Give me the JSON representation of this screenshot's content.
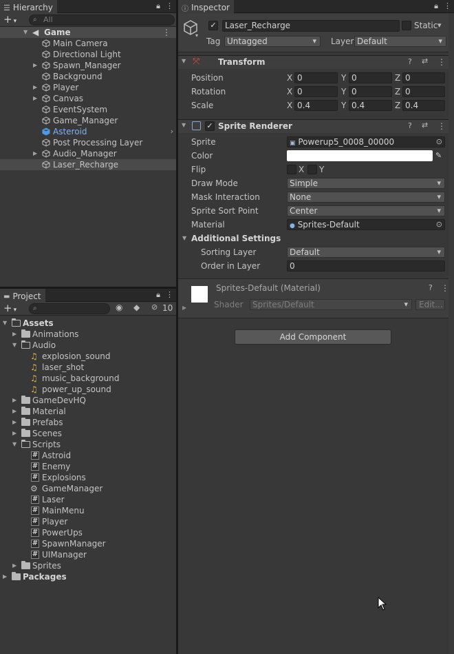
{
  "hierarchy": {
    "tab_label": "Hierarchy",
    "search_placeholder": "All",
    "add_label": "+",
    "scene_name": "Game",
    "items": [
      {
        "label": "Main Camera"
      },
      {
        "label": "Directional Light"
      },
      {
        "label": "Spawn_Manager"
      },
      {
        "label": "Background"
      },
      {
        "label": "Player"
      },
      {
        "label": "Canvas"
      },
      {
        "label": "EventSystem"
      },
      {
        "label": "Game_Manager"
      },
      {
        "label": "Asteroid"
      },
      {
        "label": "Post Processing Layer"
      },
      {
        "label": "Audio_Manager"
      },
      {
        "label": "Laser_Recharge"
      }
    ]
  },
  "project": {
    "tab_label": "Project",
    "add_label": "+",
    "hidden_count": "10",
    "tree": [
      {
        "label": "Assets"
      },
      {
        "label": "Animations"
      },
      {
        "label": "Audio"
      },
      {
        "label": "explosion_sound"
      },
      {
        "label": "laser_shot"
      },
      {
        "label": "music_background"
      },
      {
        "label": "power_up_sound"
      },
      {
        "label": "GameDevHQ"
      },
      {
        "label": "Material"
      },
      {
        "label": "Prefabs"
      },
      {
        "label": "Scenes"
      },
      {
        "label": "Scripts"
      },
      {
        "label": "Astroid"
      },
      {
        "label": "Enemy"
      },
      {
        "label": "Explosions"
      },
      {
        "label": "GameManager"
      },
      {
        "label": "Laser"
      },
      {
        "label": "MainMenu"
      },
      {
        "label": "Player"
      },
      {
        "label": "PowerUps"
      },
      {
        "label": "SpawnManager"
      },
      {
        "label": "UIManager"
      },
      {
        "label": "Sprites"
      },
      {
        "label": "Packages"
      }
    ]
  },
  "inspector": {
    "tab_label": "Inspector",
    "object_name": "Laser_Recharge",
    "static_label": "Static",
    "tag_label": "Tag",
    "tag_value": "Untagged",
    "layer_label": "Layer",
    "layer_value": "Default",
    "transform": {
      "title": "Transform",
      "position_label": "Position",
      "rotation_label": "Rotation",
      "scale_label": "Scale",
      "axis_x": "X",
      "axis_y": "Y",
      "axis_z": "Z",
      "position": {
        "x": "0",
        "y": "0",
        "z": "0"
      },
      "rotation": {
        "x": "0",
        "y": "0",
        "z": "0"
      },
      "scale": {
        "x": "0.4",
        "y": "0.4",
        "z": "0.4"
      }
    },
    "sprite_renderer": {
      "title": "Sprite Renderer",
      "sprite_label": "Sprite",
      "sprite_value": "Powerup5_0008_00000",
      "color_label": "Color",
      "color_value": "#ffffff",
      "flip_label": "Flip",
      "flip_x": "X",
      "flip_y": "Y",
      "draw_mode_label": "Draw Mode",
      "draw_mode_value": "Simple",
      "mask_label": "Mask Interaction",
      "mask_value": "None",
      "sort_point_label": "Sprite Sort Point",
      "sort_point_value": "Center",
      "material_label": "Material",
      "material_value": "Sprites-Default",
      "additional_label": "Additional Settings",
      "sorting_layer_label": "Sorting Layer",
      "sorting_layer_value": "Default",
      "order_label": "Order in Layer",
      "order_value": "0"
    },
    "material": {
      "title": "Sprites-Default (Material)",
      "shader_label": "Shader",
      "shader_value": "Sprites/Default",
      "edit_label": "Edit..."
    },
    "add_component_label": "Add Component"
  }
}
